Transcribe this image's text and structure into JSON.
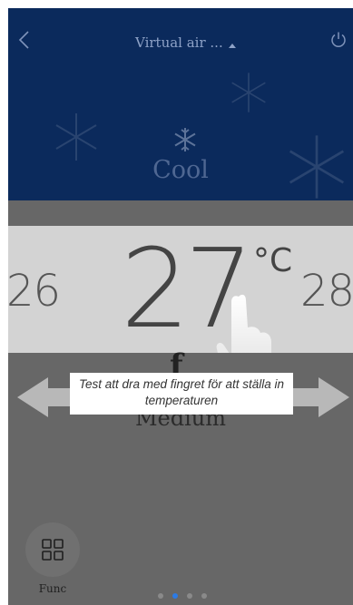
{
  "header": {
    "title": "Virtual air ...",
    "mode_label": "Cool",
    "background_color": "#0b2a5c",
    "icons": [
      "back-chevron-icon",
      "dropdown-caret-icon",
      "power-icon",
      "snowflake-icon"
    ]
  },
  "temperature": {
    "current": "27",
    "unit": "°C",
    "lower": "26",
    "higher": "28"
  },
  "fan": {
    "label": "Medium"
  },
  "overlay": {
    "caption": "Test att dra med fingret för att ställa in temperaturen"
  },
  "footer": {
    "func_label": "Func",
    "page_count": 4,
    "active_page": 2,
    "accent_color": "#2c7be5"
  }
}
